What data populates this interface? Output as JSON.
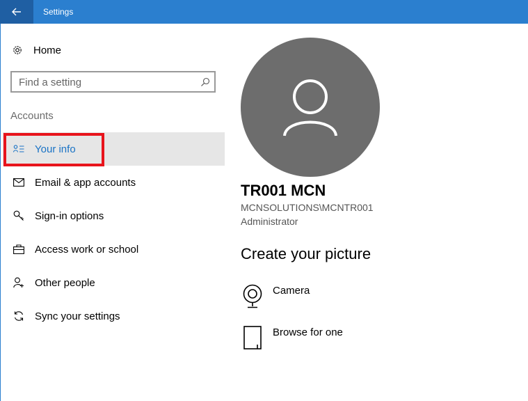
{
  "window": {
    "title": "Settings"
  },
  "sidebar": {
    "home_label": "Home",
    "search_placeholder": "Find a setting",
    "section_label": "Accounts",
    "items": [
      {
        "label": "Your info",
        "icon": "person-card-icon",
        "active": true
      },
      {
        "label": "Email & app accounts",
        "icon": "mail-icon",
        "active": false
      },
      {
        "label": "Sign-in options",
        "icon": "key-icon",
        "active": false
      },
      {
        "label": "Access work or school",
        "icon": "briefcase-icon",
        "active": false
      },
      {
        "label": "Other people",
        "icon": "person-add-icon",
        "active": false
      },
      {
        "label": "Sync your settings",
        "icon": "sync-icon",
        "active": false
      }
    ]
  },
  "main": {
    "user_name": "TR001 MCN",
    "user_account": "MCNSOLUTIONS\\MCNTR001",
    "user_role": "Administrator",
    "section_title": "Create your picture",
    "options": [
      {
        "label": "Camera",
        "icon": "camera-icon"
      },
      {
        "label": "Browse for one",
        "icon": "browse-file-icon"
      }
    ]
  },
  "colors": {
    "titlebar": "#2b7fcf",
    "back_button": "#1f5fa3",
    "accent_text": "#1a73c5",
    "active_item_bg": "#e6e6e6",
    "highlight_box": "#e8141c",
    "avatar_bg": "#6d6d6d"
  }
}
